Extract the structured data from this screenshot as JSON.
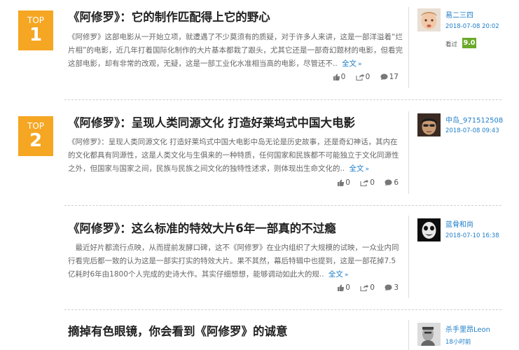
{
  "reviews": [
    {
      "rank_prefix": "TOP",
      "rank": "1",
      "title": "《阿修罗》：它的制作匹配得上它的野心",
      "summary": "《阿修罗》这部电影从一开始立项，就遭遇了不少莫须有的质疑，对于许多人来讲，这是一部洋溢着“烂片相”的电影，近几年打着国际化制作的大片基本都栽了跟头，尤其它还是一部奇幻题材的电影，但看完这部电影，却有非常的改观，无疑，这是一部工业化水准相当高的电影，尽管还不..",
      "more": "全文",
      "likes": "0",
      "shares": "0",
      "comments": "17",
      "author": "易二三四",
      "date": "2018-07-08 20:02",
      "seen_label": "看过",
      "score": "9.0"
    },
    {
      "rank_prefix": "TOP",
      "rank": "2",
      "title": "《阿修罗》：呈现人类同源文化 打造好莱坞式中国大电影",
      "summary": "《阿修罗》：呈现人类同源文化 打造好莱坞式中国大电影中岛无论是历史故事，还是奇幻神话，其内在的文化都具有同源性，这是人类文化与生俱来的一种特质，任何国家和民族都不可能独立于文化同源性之外，但国家与国家之间，民族与民族之间文化的独特性述求，则体现出生命文化的..",
      "more": "全文",
      "likes": "0",
      "shares": "0",
      "comments": "6",
      "author": "中岛_971512508",
      "date": "2018-07-08 09:43"
    },
    {
      "title": "《阿修罗》：这么标准的特效大片6年一部真的不过瘾",
      "summary": "最近好片都流行点映，从而提前发酵口碑，这不《阿修罗》在业内组织了大规模的试映，一众业内同行看完后都一致的认为这是一部实打实的特效大片。果不其然，幕后特辑中也提到，这是一部花掉7.5亿耗时6年由1800个人完成的史诗大作。其实仔细想想，能够调动如此大的规..",
      "more": "全文",
      "likes": "0",
      "shares": "0",
      "comments": "3",
      "author": "蓝骨和尚",
      "date": "2018-07-10 16:38"
    },
    {
      "title": "摘掉有色眼镜，你会看到《阿修罗》的诚意",
      "author": "杀手里昂Leon",
      "date": "18小时前"
    }
  ]
}
